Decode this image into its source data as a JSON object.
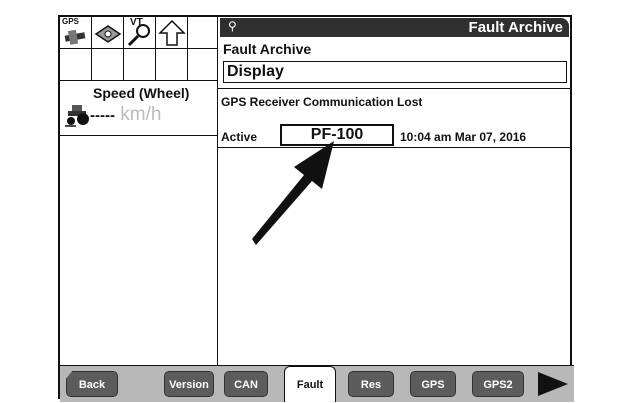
{
  "left_panel": {
    "icons": [
      {
        "name": "gps-receiver-icon",
        "label": "GPS"
      },
      {
        "name": "book-icon"
      },
      {
        "name": "vt-search-icon",
        "label": "VT"
      },
      {
        "name": "up-arrow-icon"
      }
    ],
    "speed": {
      "title": "Speed (Wheel)",
      "dashes": "-----",
      "unit": "km/h"
    }
  },
  "header": {
    "title": "Fault Archive"
  },
  "main": {
    "section_label": "Fault Archive",
    "dropdown_value": "Display",
    "fault": {
      "message": "GPS Receiver Communication Lost",
      "status": "Active",
      "code": "PF-100",
      "timestamp": "10:04 am Mar 07, 2016"
    }
  },
  "bottom_bar": {
    "buttons": [
      "Back",
      "Version",
      "CAN",
      "Fault",
      "Res",
      "GPS",
      "GPS2"
    ],
    "selected": "Fault"
  },
  "colors": {
    "title_bar": "#2f2f2f",
    "button": "#5c5c5c",
    "bottom_bg": "#b8b8b8"
  }
}
